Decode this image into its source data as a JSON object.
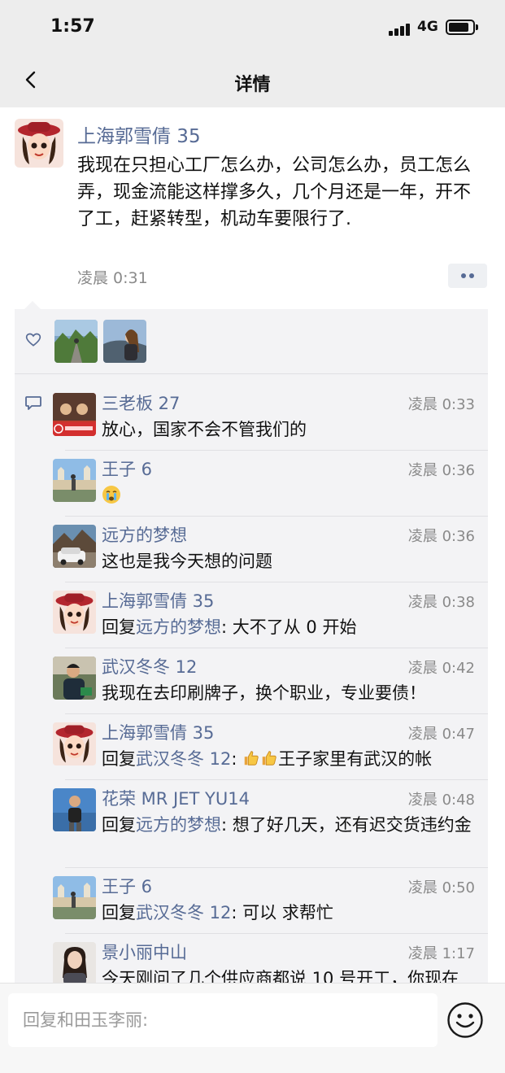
{
  "status_bar": {
    "time": "1:57",
    "network": "4G",
    "battery_level": 0.85
  },
  "nav": {
    "title": "详情"
  },
  "post": {
    "author": "上海郭雪倩 35",
    "text": "我现在只担心工厂怎么办，公司怎么办，员工怎么弄，现金流能这样撑多久，几个月还是一年，开不了工，赶紧转型，机动车要限行了.",
    "time": "凌晨 0:31"
  },
  "likes": {
    "count": 2
  },
  "comments": [
    {
      "name": "三老板 27",
      "time": "凌晨 0:33",
      "text": "放心，国家不会不管我们的"
    },
    {
      "name": "王子 6",
      "time": "凌晨 0:36",
      "text": "",
      "emoji": "crying-face"
    },
    {
      "name": "远方的梦想",
      "time": "凌晨 0:36",
      "text": "这也是我今天想的问题"
    },
    {
      "name": "上海郭雪倩 35",
      "time": "凌晨 0:38",
      "reply_prefix": "回复",
      "reply_to": "远方的梦想",
      "text": ": 大不了从 0 开始"
    },
    {
      "name": "武汉冬冬 12",
      "time": "凌晨 0:42",
      "text": "我现在去印刷牌子，换个职业，专业要债！"
    },
    {
      "name": "上海郭雪倩 35",
      "time": "凌晨 0:47",
      "reply_prefix": "回复",
      "reply_to": "武汉冬冬 12",
      "text": "王子家里有武汉的帐",
      "emoji": "thumbs-up-x2"
    },
    {
      "name": "花荣 MR JET YU14",
      "time": "凌晨 0:48",
      "reply_prefix": "回复",
      "reply_to": "远方的梦想",
      "text": ": 想了好几天，还有迟交货违约金"
    },
    {
      "name": "王子 6",
      "time": "凌晨 0:50",
      "reply_prefix": "回复",
      "reply_to": "武汉冬冬 12",
      "text": ": 可以 求帮忙"
    },
    {
      "name": "景小丽中山",
      "time": "凌晨 1:17",
      "text": "今天刚问了几个供应商都说 10 号开工，你现在"
    }
  ],
  "input": {
    "placeholder": "回复和田玉李丽:"
  },
  "colors": {
    "link": "#576b95",
    "nav_bg": "#ededed",
    "panel_bg": "#f3f3f5"
  }
}
